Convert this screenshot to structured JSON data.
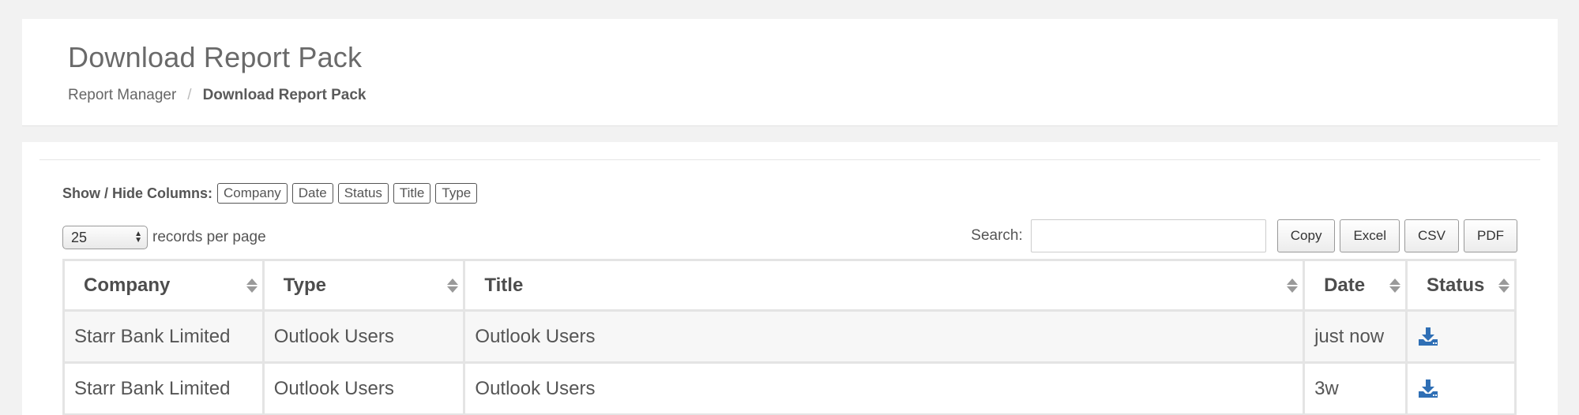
{
  "header": {
    "title": "Download Report Pack",
    "breadcrumb": [
      {
        "label": "Report Manager"
      },
      {
        "separator": "/"
      },
      {
        "label": "Download Report Pack"
      }
    ]
  },
  "column_visibility": {
    "label": "Show / Hide Columns:",
    "buttons": [
      "Company",
      "Date",
      "Status",
      "Title",
      "Type"
    ]
  },
  "length": {
    "value": "25",
    "suffix": "records per page"
  },
  "search": {
    "label": "Search:",
    "value": "",
    "placeholder": ""
  },
  "export_buttons": [
    "Copy",
    "Excel",
    "CSV",
    "PDF"
  ],
  "table": {
    "headers": [
      "Company",
      "Type",
      "Title",
      "Date",
      "Status"
    ],
    "rows": [
      {
        "company": "Starr Bank Limited",
        "type": "Outlook Users",
        "title": "Outlook Users",
        "date": "just now",
        "status_icon": "download-icon"
      },
      {
        "company": "Starr Bank Limited",
        "type": "Outlook Users",
        "title": "Outlook Users",
        "date": "3w",
        "status_icon": "download-icon"
      }
    ]
  },
  "colors": {
    "page_bg": "#f2f2f2",
    "panel_bg": "#ffffff",
    "icon_blue": "#2f6fb5",
    "odd_row": "#f7f7f7"
  }
}
